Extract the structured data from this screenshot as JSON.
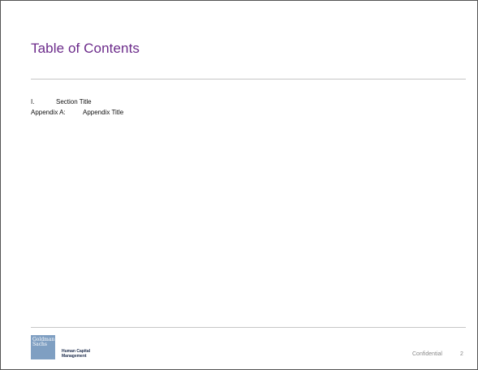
{
  "slide": {
    "title": "Table of Contents",
    "toc": [
      {
        "number": "I.",
        "text": "Section Title"
      },
      {
        "number": "Appendix A:",
        "text": "Appendix Title"
      }
    ]
  },
  "footer": {
    "logo": {
      "icon": "goldman-sachs-logo",
      "line1": "Goldman",
      "line2": "Sachs",
      "color": "#7f9fc2"
    },
    "brand_line1": "Human Capital",
    "brand_line2": "Management",
    "confidential": "Confidential",
    "page_number": "2"
  },
  "colors": {
    "title": "#6b2a8a",
    "rule": "#c6c6c6",
    "footer_text": "#8a8a8a"
  }
}
